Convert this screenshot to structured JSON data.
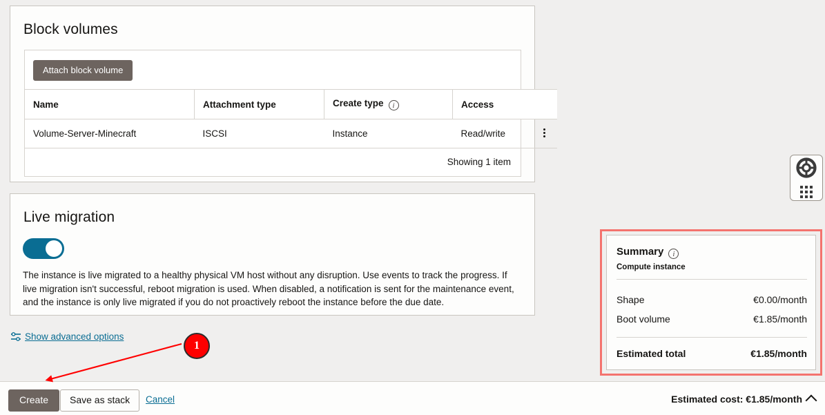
{
  "block_volumes": {
    "title": "Block volumes",
    "attach_button": "Attach block volume",
    "columns": [
      {
        "label": "Name",
        "has_info": false
      },
      {
        "label": "Attachment type",
        "has_info": false
      },
      {
        "label": "Create type",
        "has_info": true
      },
      {
        "label": "Access",
        "has_info": false
      }
    ],
    "rows": [
      {
        "name": "Volume-Server-Minecraft",
        "attachment_type": "ISCSI",
        "create_type": "Instance",
        "access": "Read/write",
        "menu_icon": "kebab-menu-icon"
      }
    ],
    "footer": "Showing 1 item"
  },
  "live_migration": {
    "title": "Live migration",
    "toggle": {
      "state": "on",
      "icon": "toggle-switch-on"
    },
    "description": "The instance is live migrated to a healthy physical VM host without any disruption. Use events to track the progress. If live migration isn't successful, reboot migration is used. When disabled, a notification is sent for the maintenance event, and the instance is only live migrated if you do not proactively reboot the instance before the due date."
  },
  "advanced_options": {
    "label": "Show advanced options",
    "icon": "sliders-icon"
  },
  "summary": {
    "title": "Summary",
    "info_icon": "info-circle-icon",
    "subtitle": "Compute instance",
    "rows": [
      {
        "label": "Shape",
        "value": "€0.00/month"
      },
      {
        "label": "Boot volume",
        "value": "€1.85/month"
      }
    ],
    "total": {
      "label": "Estimated total",
      "value": "€1.85/month"
    },
    "highlight_color": "#f4736e"
  },
  "bottom_bar": {
    "create_label": "Create",
    "save_as_stack_label": "Save as stack",
    "cancel_label": "Cancel",
    "estimated_cost": "Estimated cost: €1.85/month",
    "chevron_icon": "chevron-up-icon"
  },
  "help_widget": {
    "icon": "lifebuoy-icon",
    "grid_icon": "dots-grid-icon"
  },
  "annotation": {
    "badge_number": "1",
    "badge_color": "#fe0000",
    "arrow_color": "#ff0000"
  }
}
